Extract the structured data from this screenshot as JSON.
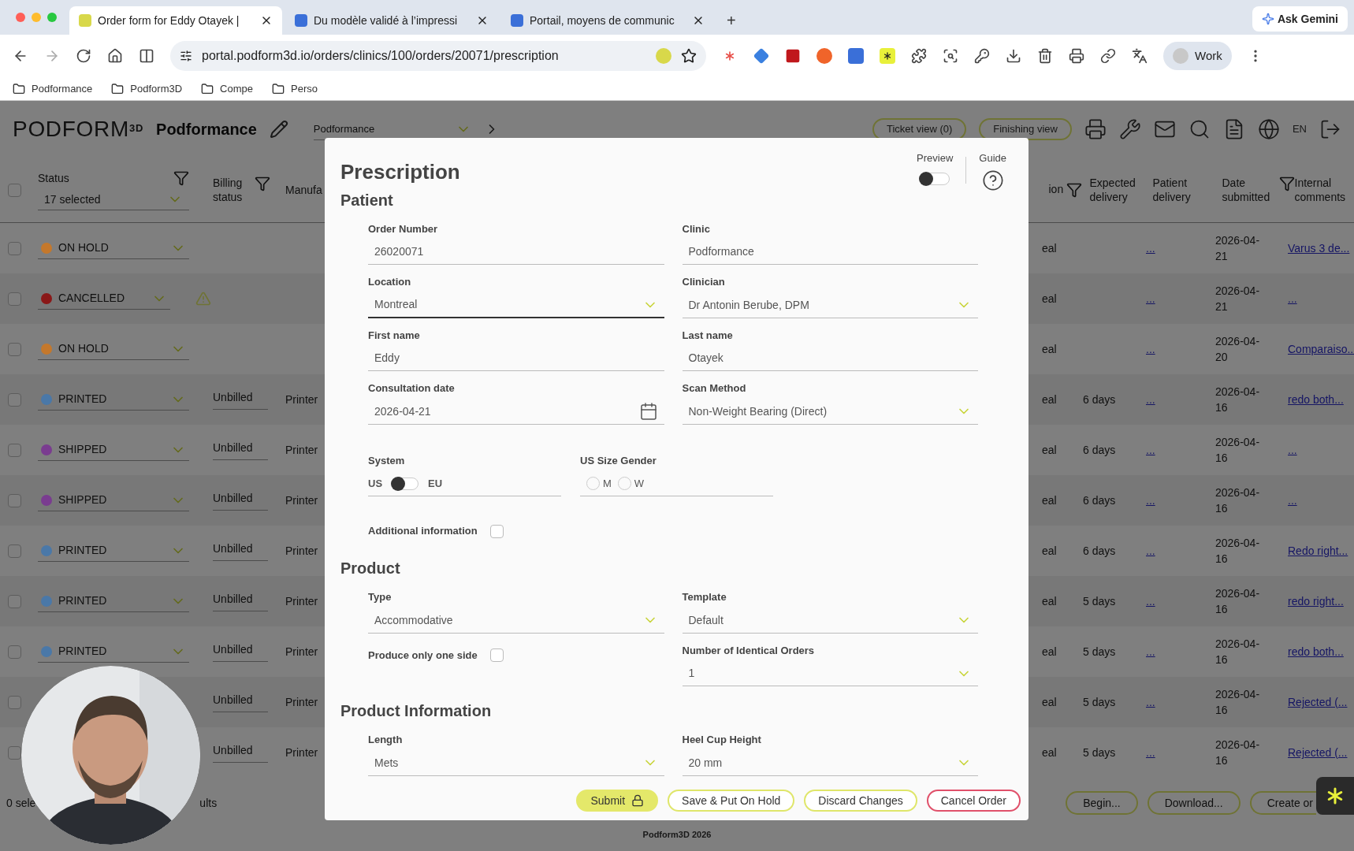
{
  "browser": {
    "tabs": [
      {
        "title": "Order form for Eddy Otayek |",
        "selected": true
      },
      {
        "title": "Du modèle validé à l’impressi",
        "selected": false
      },
      {
        "title": "Portail, moyens de communic",
        "selected": false
      }
    ],
    "new_tab": "+",
    "ask_gemini": "Ask Gemini",
    "url": "portal.podform3d.io/orders/clinics/100/orders/20071/prescription",
    "profile": "Work",
    "bookmarks": [
      "Podformance",
      "Podform3D",
      "Compe",
      "Perso"
    ]
  },
  "app_header": {
    "logo": "PODFORM$^{3D}$",
    "organization": "Podformance",
    "account_select": "Podformance",
    "views": [
      "Ticket view (0)",
      "Finishing view"
    ],
    "language": "EN"
  },
  "table": {
    "select_all_checked": false,
    "left_columns": [
      {
        "label": "Status",
        "filter": true,
        "value": "17 selected"
      },
      {
        "label": "Billing status",
        "filter": true
      },
      {
        "label": "Manufa",
        "filter": false
      }
    ],
    "right_columns": [
      {
        "label": "ion",
        "filter": true
      },
      {
        "label": "Expected delivery",
        "filter": false
      },
      {
        "label": "Patient delivery",
        "filter": false
      },
      {
        "label": "Date submitted",
        "filter": true
      },
      {
        "label": "Internal comments",
        "filter": false
      }
    ],
    "rows": [
      {
        "checked": false,
        "status": "ON HOLD",
        "color": "#c4782c",
        "warning": false,
        "billing": "",
        "manufacturer": "",
        "column_1": "eal",
        "expected": "",
        "patient_delivery": "...",
        "date": "2026-04-21",
        "comment": "Varus 3 de..."
      },
      {
        "checked": false,
        "status": "CANCELLED",
        "color": "#8a1818",
        "warning": true,
        "billing": "",
        "manufacturer": "",
        "column_1": "eal",
        "expected": "",
        "patient_delivery": "...",
        "date": "2026-04-21",
        "comment": "..."
      },
      {
        "checked": false,
        "status": "ON HOLD",
        "color": "#c4782c",
        "warning": false,
        "billing": "",
        "manufacturer": "",
        "column_1": "eal",
        "expected": "",
        "patient_delivery": "...",
        "date": "2026-04-20",
        "comment": "Comparaiso..."
      },
      {
        "checked": false,
        "status": "PRINTED",
        "color": "#4a78a8",
        "warning": false,
        "billing": "Unbilled",
        "manufacturer": "Printer",
        "column_1": "eal",
        "expected": "6 days",
        "patient_delivery": "...",
        "date": "2026-04-16",
        "comment": "redo both..."
      },
      {
        "checked": false,
        "status": "SHIPPED",
        "color": "#7a3c90",
        "warning": false,
        "billing": "Unbilled",
        "manufacturer": "Printer",
        "column_1": "eal",
        "expected": "6 days",
        "patient_delivery": "...",
        "date": "2026-04-16",
        "comment": "..."
      },
      {
        "checked": false,
        "status": "SHIPPED",
        "color": "#7a3c90",
        "warning": false,
        "billing": "Unbilled",
        "manufacturer": "Printer",
        "column_1": "eal",
        "expected": "6 days",
        "patient_delivery": "...",
        "date": "2026-04-16",
        "comment": "..."
      },
      {
        "checked": false,
        "status": "PRINTED",
        "color": "#4a78a8",
        "warning": false,
        "billing": "Unbilled",
        "manufacturer": "Printer",
        "column_1": "eal",
        "expected": "6 days",
        "patient_delivery": "...",
        "date": "2026-04-16",
        "comment": "Redo right..."
      },
      {
        "checked": false,
        "status": "PRINTED",
        "color": "#4a78a8",
        "warning": false,
        "billing": "Unbilled",
        "manufacturer": "Printer",
        "column_1": "eal",
        "expected": "5 days",
        "patient_delivery": "...",
        "date": "2026-04-16",
        "comment": "redo right..."
      },
      {
        "checked": false,
        "status": "PRINTED",
        "color": "#4a78a8",
        "warning": false,
        "billing": "Unbilled",
        "manufacturer": "Printer",
        "column_1": "eal",
        "expected": "5 days",
        "patient_delivery": "...",
        "date": "2026-04-16",
        "comment": "redo both..."
      },
      {
        "checked": false,
        "billing": "Unbilled",
        "manufacturer": "Printer",
        "column_1": "eal",
        "expected": "5 days",
        "patient_delivery": "...",
        "date": "2026-04-16",
        "comment": "Rejected (..."
      },
      {
        "checked": false,
        "billing": "Unbilled",
        "manufacturer": "Printer",
        "column_1": "eal",
        "expected": "5 days",
        "patient_delivery": "...",
        "date": "2026-04-16",
        "comment": "Rejected (..."
      }
    ],
    "footer": {
      "selection": "0 sele",
      "results": "ults",
      "buttons": [
        "Begin...",
        "Download...",
        "Create or"
      ]
    }
  },
  "copyright": "Podform3D 2026",
  "modal": {
    "title": "Prescription",
    "preview": {
      "label": "Preview",
      "on": false
    },
    "guide": "Guide",
    "sections": [
      {
        "title": "Patient",
        "fields": [
          {
            "kind": "text",
            "label": "Order Number",
            "value": "26020071"
          },
          {
            "kind": "text",
            "label": "Clinic",
            "value": "Podformance"
          },
          {
            "kind": "select",
            "label": "Location",
            "value": "Montreal",
            "focused": true
          },
          {
            "kind": "select",
            "label": "Clinician",
            "value": "Dr Antonin Berube, DPM",
            "focused": false
          },
          {
            "kind": "text",
            "label": "First name",
            "value": "Eddy"
          },
          {
            "kind": "text",
            "label": "Last name",
            "value": "Otayek"
          },
          {
            "kind": "date",
            "label": "Consultation date",
            "value": "2026-04-21"
          },
          {
            "kind": "select",
            "label": "Scan Method",
            "value": "Non-Weight Bearing (Direct)",
            "focused": false
          },
          {
            "kind": "toggle",
            "label": "System",
            "left": "US",
            "right": "EU",
            "on": false
          },
          {
            "kind": "radio",
            "label": "US Size Gender",
            "options": [
              {
                "label": "M",
                "selected": false
              },
              {
                "label": "W",
                "selected": false
              }
            ]
          },
          {
            "kind": "checkbox",
            "label": "Additional information",
            "checked": false
          }
        ]
      },
      {
        "title": "Product",
        "fields": [
          {
            "kind": "select",
            "label": "Type",
            "value": "Accommodative",
            "focused": false
          },
          {
            "kind": "select",
            "label": "Template",
            "value": "Default",
            "focused": false
          },
          {
            "kind": "checkbox",
            "label": "Produce only one side",
            "checked": false
          },
          {
            "kind": "select",
            "label": "Number of Identical Orders",
            "value": "1",
            "focused": false
          }
        ]
      },
      {
        "title": "Product Information",
        "fields": [
          {
            "kind": "select",
            "label": "Length",
            "value": "Mets",
            "focused": false
          },
          {
            "kind": "select",
            "label": "Heel Cup Height",
            "value": "20 mm",
            "focused": false
          }
        ]
      }
    ],
    "buttons": [
      {
        "kind": "primary",
        "label": "Submit",
        "locked": true
      },
      {
        "kind": "outline",
        "label": "Save & Put On Hold",
        "locked": false
      },
      {
        "kind": "outline",
        "label": "Discard Changes",
        "locked": false
      },
      {
        "kind": "danger",
        "label": "Cancel Order",
        "locked": false
      }
    ]
  }
}
